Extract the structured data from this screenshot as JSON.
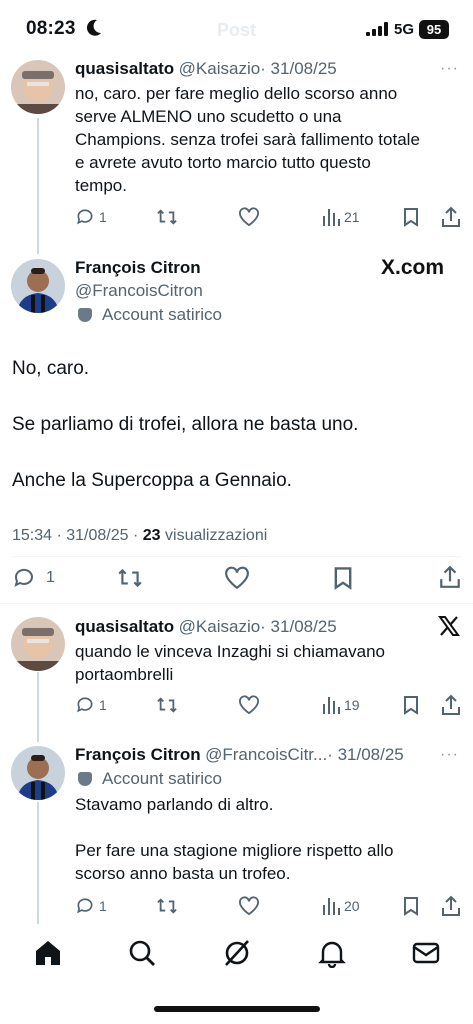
{
  "status_bar": {
    "time": "08:23",
    "header_ghost": "Post",
    "network": "5G",
    "battery": "95"
  },
  "reply1": {
    "name": "quasisaltato",
    "handle": "@Kaisazio",
    "date": "· 31/08/25",
    "more": "···",
    "lines": [
      "no, caro. per fare meglio dello scorso anno",
      "serve ALMENO uno scudetto o una",
      "Champions. senza trofei sarà fallimento totale",
      "e avrete avuto torto marcio tutto questo",
      "tempo."
    ],
    "replies": "1",
    "views": "21"
  },
  "main": {
    "name": "François Citron",
    "handle": "@FrancoisCitron",
    "badge": "Account satirico",
    "brand": "X.com",
    "lines": [
      "No, caro.",
      "Se parliamo di trofei, allora ne basta uno.",
      "Anche la Supercoppa a Gennaio."
    ],
    "timestamp": "15:34 · 31/08/25 ·",
    "view_count": "23",
    "views_label": "visualizzazioni",
    "replies": "1"
  },
  "reply2": {
    "name": "quasisaltato",
    "handle": "@Kaisazio",
    "date": "· 31/08/25",
    "lines": [
      "quando le vinceva Inzaghi si chiamavano",
      "portaombrelli"
    ],
    "replies": "1",
    "views": "19"
  },
  "reply3": {
    "name": "François Citron",
    "handle": "@FrancoisCitr...",
    "date": "· 31/08/25",
    "more": "···",
    "badge": "Account satirico",
    "lines": [
      "Stavamo parlando di altro.",
      "",
      "Per fare una stagione migliore rispetto allo",
      "scorso anno basta un trofeo."
    ],
    "replies": "1",
    "views": "20"
  },
  "tabs": [
    "home-icon",
    "search-icon",
    "grok-icon",
    "notifications-icon",
    "messages-icon"
  ],
  "colors": {
    "text": "#0f1419",
    "secondary": "#536471",
    "line": "#cfd9de"
  }
}
